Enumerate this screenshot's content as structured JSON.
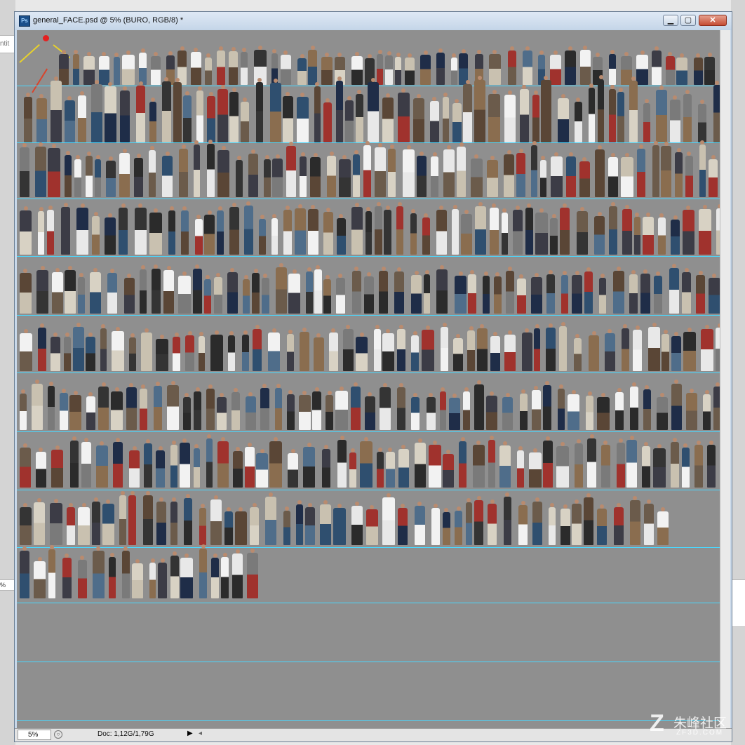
{
  "background": {
    "left_clip_text": "ntit",
    "left_zoom_text": "%"
  },
  "window": {
    "app_icon_label": "Ps",
    "title": "general_FACE.psd @ 5% (BURO, RGB/8) *",
    "buttons": {
      "minimize": "▁",
      "maximize": "▢",
      "close": "✕"
    }
  },
  "canvas": {
    "background_color": "#8f8f8f",
    "guide_color": "#49d8ff",
    "guide_count": 12
  },
  "statusbar": {
    "zoom": "5%",
    "doc_info": "Doc: 1,12G/1,79G",
    "arrow": "▶",
    "scroll_left": "◂"
  },
  "watermark": {
    "logo": "Z",
    "text": "朱峰社区",
    "url": "ZF3D.COM"
  },
  "icons": {
    "app": "photoshop-icon",
    "minimize": "minimize-icon",
    "maximize": "maximize-icon",
    "close": "close-icon",
    "status": "info-icon"
  }
}
